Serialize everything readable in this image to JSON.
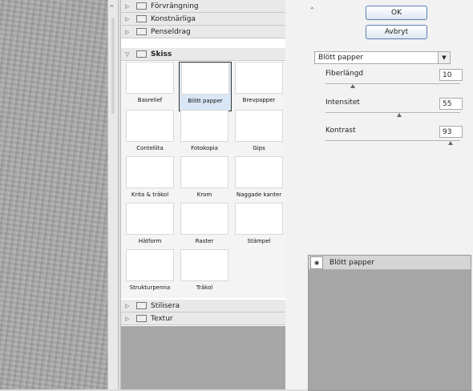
{
  "categories": {
    "top": [
      {
        "label": "Förvrängning"
      },
      {
        "label": "Konstnärliga"
      },
      {
        "label": "Penseldrag"
      }
    ],
    "open": {
      "label": "Skiss"
    },
    "bottom": [
      {
        "label": "Stilisera"
      },
      {
        "label": "Textur"
      }
    ]
  },
  "filters": [
    {
      "label": "Basrelief",
      "style": "relief"
    },
    {
      "label": "Blött papper",
      "style": "water",
      "selected": true
    },
    {
      "label": "Brevpapper",
      "style": "white"
    },
    {
      "label": "Conteliita",
      "style": "light"
    },
    {
      "label": "Fotokopia",
      "style": "dark"
    },
    {
      "label": "Gips",
      "style": "light"
    },
    {
      "label": "Krita & träkol",
      "style": "gray"
    },
    {
      "label": "Krom",
      "style": "gray"
    },
    {
      "label": "Naggade kanter",
      "style": "dark"
    },
    {
      "label": "Hätform",
      "style": "bw"
    },
    {
      "label": "Raster",
      "style": "relief"
    },
    {
      "label": "Stämpel",
      "style": "black"
    },
    {
      "label": "Strukturpenna",
      "style": "bw"
    },
    {
      "label": "Träkol",
      "style": "sketch"
    }
  ],
  "buttons": {
    "ok": "OK",
    "cancel": "Avbryt"
  },
  "filter_select": {
    "value": "Blött papper"
  },
  "params": [
    {
      "label": "Fiberlängd",
      "value": "10",
      "fraction": 0.2
    },
    {
      "label": "Intensitet",
      "value": "55",
      "fraction": 0.55
    },
    {
      "label": "Kontrast",
      "value": "93",
      "fraction": 0.93
    }
  ],
  "layer": {
    "label": "Blött papper"
  },
  "icons": {
    "collapse": "double-chevron-up-icon",
    "eye": "eye-icon",
    "folder": "folder-icon"
  }
}
